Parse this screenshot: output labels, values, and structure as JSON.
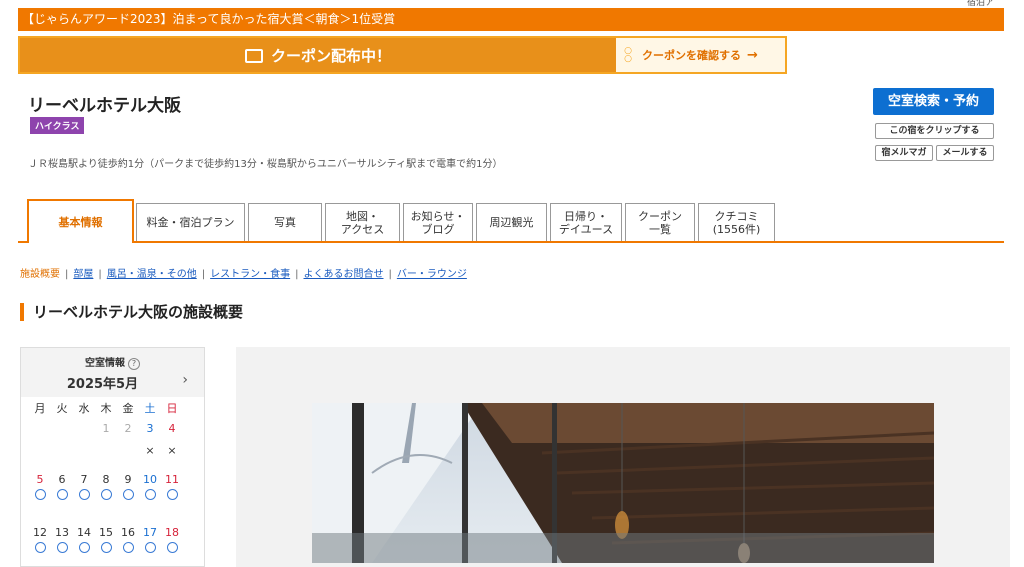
{
  "top_right_text": "宿泊ア",
  "award_text": "【じゃらんアワード2023】泊まって良かった宿大賞＜朝食＞1位受賞",
  "coupon": {
    "label": "クーポン配布中！",
    "link": "クーポンを確認する",
    "arrow": "→"
  },
  "hotel": {
    "name": "リーベルホテル大阪",
    "class": "ハイクラス",
    "access": "ＪＲ桜島駅より徒歩約1分（パークまで徒歩約13分・桜島駅からユニバーサルシティ駅まで電車で約1分）"
  },
  "buttons": {
    "search": "空室検索・予約",
    "clip": "この宿をクリップする",
    "mag": "宿メルマガ",
    "mail": "メールする"
  },
  "tabs": [
    "基本情報",
    "料金・宿泊プラン",
    "写真",
    "地図・\nアクセス",
    "お知らせ・\nブログ",
    "周辺観光",
    "日帰り・\nデイユース",
    "クーポン\n一覧",
    "クチコミ\n(1556件)"
  ],
  "subnav": {
    "current": "施設概要",
    "links": [
      "部屋",
      "風呂・温泉・その他",
      "レストラン・食事",
      "よくあるお問合せ",
      "バー・ラウンジ"
    ]
  },
  "section_title": "リーベルホテル大阪の施設概要",
  "calendar": {
    "title": "空室情報",
    "help_icon": "?",
    "month": "2025年5月",
    "next": "›",
    "weekdays": [
      "月",
      "火",
      "水",
      "木",
      "金",
      "土",
      "日"
    ],
    "week1": [
      "",
      "",
      "",
      "1",
      "2",
      "3",
      "4"
    ],
    "week1_marks": [
      "",
      "",
      "",
      "",
      "",
      "×",
      "×"
    ],
    "week2": [
      "5",
      "6",
      "7",
      "8",
      "9",
      "10",
      "11"
    ],
    "week3": [
      "12",
      "13",
      "14",
      "15",
      "16",
      "17",
      "18"
    ]
  },
  "colors": {
    "accent": "#f07800",
    "primary": "#0d6fd1",
    "badge": "#8e44ad"
  }
}
